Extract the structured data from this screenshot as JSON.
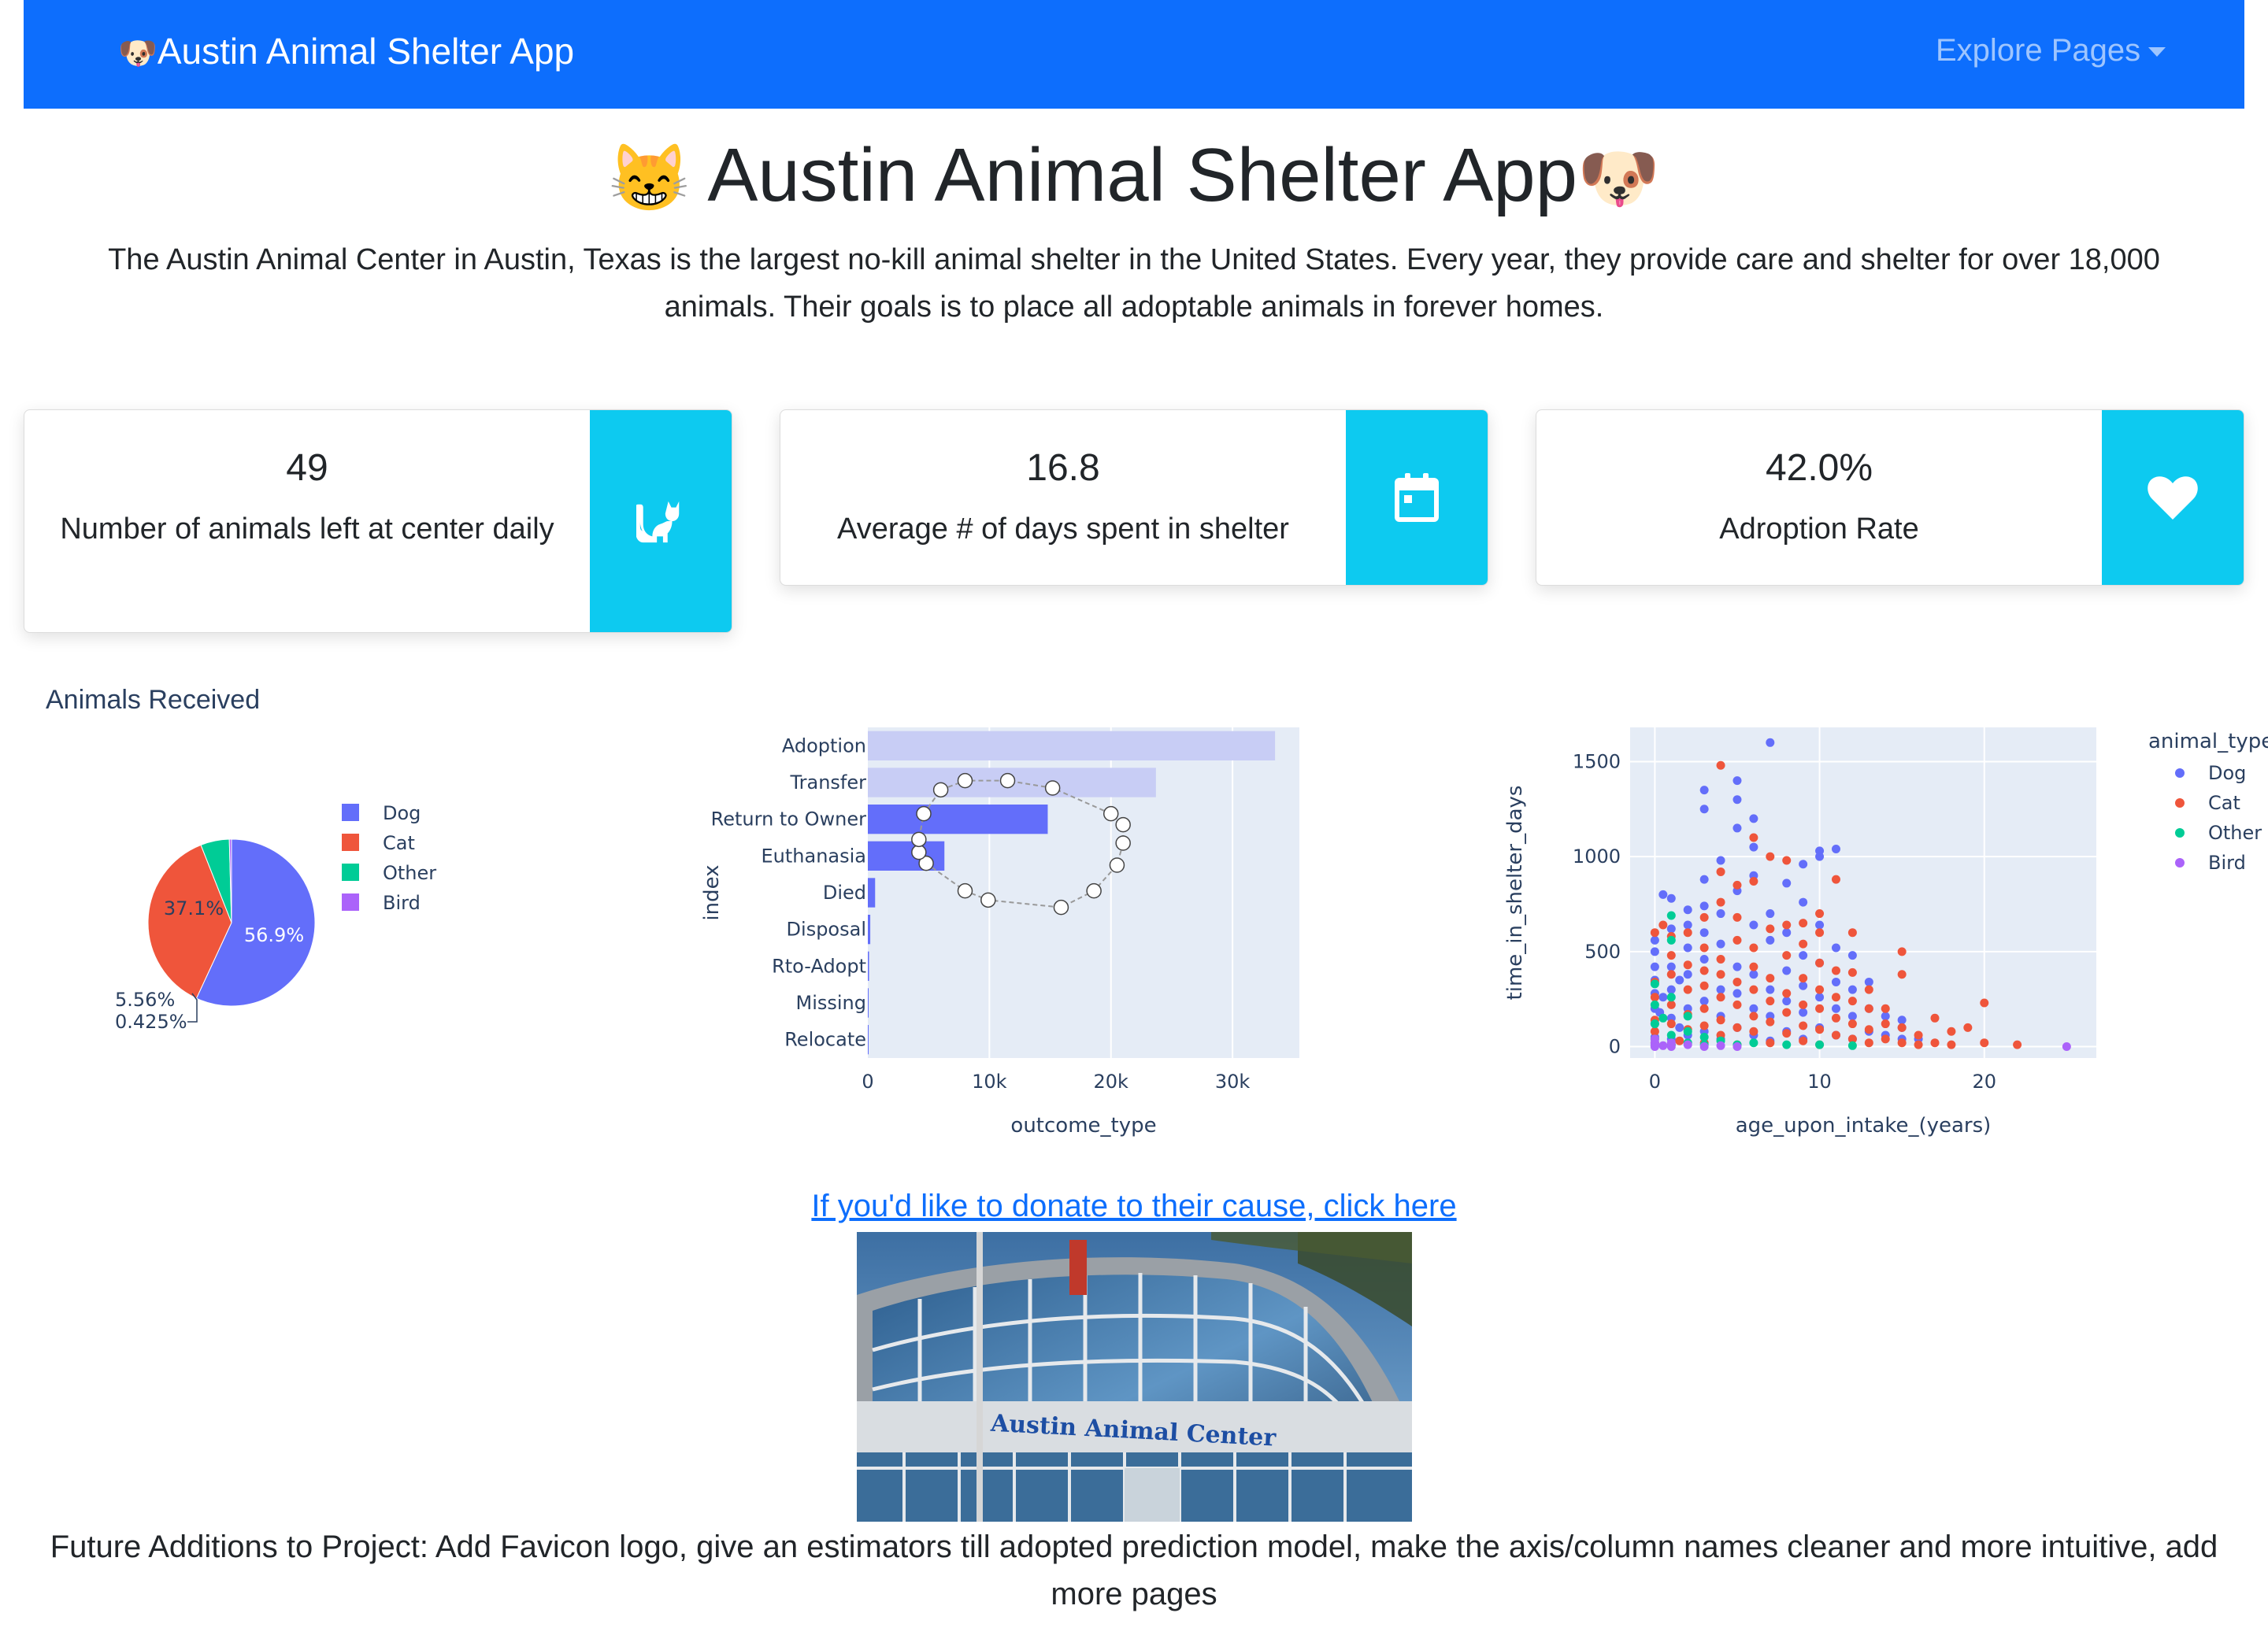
{
  "navbar": {
    "brand": "Austin Animal Shelter App",
    "brand_icon": "dog-face-icon",
    "explore_label": "Explore Pages"
  },
  "header": {
    "title": "Austin Animal Shelter App",
    "title_left_icon": "grinning-cat-icon",
    "title_right_icon": "dog-face-icon",
    "intro": "The Austin Animal Center in Austin, Texas is the largest no-kill animal shelter in the United States. Every year, they provide care and shelter for over 18,000 animals. Their goals is to place all adoptable animals in forever homes."
  },
  "stats": [
    {
      "value": "49",
      "label": "Number of animals left at center daily",
      "icon": "cat-icon"
    },
    {
      "value": "16.8",
      "label": "Average # of days spent in shelter",
      "icon": "calendar-icon"
    },
    {
      "value": "42.0%",
      "label": "Adroption Rate",
      "icon": "heart-icon"
    }
  ],
  "colors": {
    "navbar": "#0d6efd",
    "card_icon_bg": "#0dcaf0",
    "dog": "#636efa",
    "cat": "#EF553B",
    "other": "#00cc96",
    "bird": "#ab63fa",
    "plot_bg": "#e5ecf6",
    "text_dark": "#2a3f5f"
  },
  "chart_data": [
    {
      "type": "pie",
      "title": "Animals Received",
      "labels": [
        "Dog",
        "Cat",
        "Other",
        "Bird"
      ],
      "values": [
        56.9,
        37.1,
        5.56,
        0.425
      ],
      "value_labels": [
        "56.9%",
        "37.1%",
        "5.56%",
        "0.425%"
      ],
      "legend": "right"
    },
    {
      "type": "bar",
      "orientation": "horizontal",
      "categories": [
        "Adoption",
        "Transfer",
        "Return to Owner",
        "Euthanasia",
        "Died",
        "Disposal",
        "Rto-Adopt",
        "Missing",
        "Relocate"
      ],
      "values": [
        33500,
        23700,
        14800,
        6300,
        600,
        200,
        100,
        50,
        20
      ],
      "xlabel": "outcome_type",
      "ylabel": "index",
      "xlim": [
        0,
        35500
      ],
      "xticks": [
        "0",
        "10k",
        "20k",
        "30k"
      ],
      "grid": true,
      "selection_lasso_points": [
        [
          6000,
          1.2
        ],
        [
          8000,
          0.95
        ],
        [
          11500,
          0.95
        ],
        [
          15200,
          1.15
        ],
        [
          20000,
          1.85
        ],
        [
          21000,
          2.15
        ],
        [
          21000,
          2.65
        ],
        [
          20500,
          3.25
        ],
        [
          18600,
          3.95
        ],
        [
          15900,
          4.4
        ],
        [
          9900,
          4.2
        ],
        [
          8000,
          3.95
        ],
        [
          4800,
          3.2
        ],
        [
          4200,
          2.9
        ],
        [
          4200,
          2.55
        ],
        [
          4600,
          1.85
        ]
      ]
    },
    {
      "type": "scatter",
      "xlabel": "age_upon_intake_(years)",
      "ylabel": "time_in_shelter_days",
      "xlim": [
        -1.5,
        26.8
      ],
      "ylim": [
        -60,
        1680
      ],
      "xticks": [
        0,
        10,
        20
      ],
      "yticks": [
        0,
        500,
        1000,
        1500
      ],
      "legend_title": "animal_type",
      "legend": "right",
      "series": [
        {
          "name": "Dog",
          "points": [
            [
              0,
              50
            ],
            [
              0,
              120
            ],
            [
              0,
              200
            ],
            [
              0,
              280
            ],
            [
              0,
              350
            ],
            [
              0,
              420
            ],
            [
              0,
              500
            ],
            [
              0,
              560
            ],
            [
              0.3,
              180
            ],
            [
              0.5,
              260
            ],
            [
              0.5,
              800
            ],
            [
              1,
              40
            ],
            [
              1,
              150
            ],
            [
              1,
              300
            ],
            [
              1,
              420
            ],
            [
              1,
              620
            ],
            [
              1,
              780
            ],
            [
              1.5,
              100
            ],
            [
              1.5,
              350
            ],
            [
              2,
              60
            ],
            [
              2,
              200
            ],
            [
              2,
              380
            ],
            [
              2,
              520
            ],
            [
              2,
              640
            ],
            [
              2,
              720
            ],
            [
              3,
              80
            ],
            [
              3,
              240
            ],
            [
              3,
              460
            ],
            [
              3,
              600
            ],
            [
              3,
              740
            ],
            [
              3,
              880
            ],
            [
              3,
              1250
            ],
            [
              3,
              1350
            ],
            [
              4,
              40
            ],
            [
              4,
              160
            ],
            [
              4,
              300
            ],
            [
              4,
              540
            ],
            [
              4,
              700
            ],
            [
              4,
              980
            ],
            [
              5,
              100
            ],
            [
              5,
              280
            ],
            [
              5,
              420
            ],
            [
              5,
              820
            ],
            [
              5,
              1150
            ],
            [
              5,
              1300
            ],
            [
              5,
              1400
            ],
            [
              6,
              60
            ],
            [
              6,
              200
            ],
            [
              6,
              380
            ],
            [
              6,
              640
            ],
            [
              6,
              900
            ],
            [
              6,
              1050
            ],
            [
              6,
              1200
            ],
            [
              7,
              30
            ],
            [
              7,
              160
            ],
            [
              7,
              300
            ],
            [
              7,
              560
            ],
            [
              7,
              700
            ],
            [
              7,
              1600
            ],
            [
              8,
              80
            ],
            [
              8,
              240
            ],
            [
              8,
              400
            ],
            [
              8,
              600
            ],
            [
              8,
              860
            ],
            [
              9,
              40
            ],
            [
              9,
              180
            ],
            [
              9,
              320
            ],
            [
              9,
              480
            ],
            [
              9,
              760
            ],
            [
              9,
              960
            ],
            [
              10,
              100
            ],
            [
              10,
              260
            ],
            [
              10,
              440
            ],
            [
              10,
              640
            ],
            [
              10,
              1000
            ],
            [
              10,
              1030
            ],
            [
              11,
              60
            ],
            [
              11,
              200
            ],
            [
              11,
              340
            ],
            [
              11,
              520
            ],
            [
              11,
              1040
            ],
            [
              12,
              40
            ],
            [
              12,
              160
            ],
            [
              12,
              300
            ],
            [
              12,
              480
            ],
            [
              13,
              80
            ],
            [
              13,
              200
            ],
            [
              13,
              340
            ],
            [
              14,
              60
            ],
            [
              14,
              160
            ],
            [
              15,
              40
            ],
            [
              15,
              140
            ],
            [
              15,
              100
            ],
            [
              16,
              40
            ]
          ]
        },
        {
          "name": "Cat",
          "points": [
            [
              0,
              20
            ],
            [
              0,
              80
            ],
            [
              0,
              140
            ],
            [
              0,
              260
            ],
            [
              0,
              340
            ],
            [
              0,
              600
            ],
            [
              0.5,
              640
            ],
            [
              1,
              10
            ],
            [
              1,
              120
            ],
            [
              1,
              220
            ],
            [
              1,
              380
            ],
            [
              1,
              480
            ],
            [
              1,
              580
            ],
            [
              1.5,
              30
            ],
            [
              2,
              90
            ],
            [
              2,
              170
            ],
            [
              2,
              300
            ],
            [
              2,
              430
            ],
            [
              2,
              600
            ],
            [
              3,
              20
            ],
            [
              3,
              110
            ],
            [
              3,
              200
            ],
            [
              3,
              320
            ],
            [
              3,
              400
            ],
            [
              3,
              520
            ],
            [
              3,
              680
            ],
            [
              4,
              1480
            ],
            [
              4,
              60
            ],
            [
              4,
              140
            ],
            [
              4,
              260
            ],
            [
              4,
              380
            ],
            [
              4,
              460
            ],
            [
              4,
              760
            ],
            [
              4,
              920
            ],
            [
              5,
              10
            ],
            [
              5,
              100
            ],
            [
              5,
              220
            ],
            [
              5,
              340
            ],
            [
              5,
              560
            ],
            [
              5,
              680
            ],
            [
              5,
              850
            ],
            [
              6,
              80
            ],
            [
              6,
              160
            ],
            [
              6,
              300
            ],
            [
              6,
              420
            ],
            [
              6,
              520
            ],
            [
              6,
              870
            ],
            [
              6,
              1100
            ],
            [
              7,
              20
            ],
            [
              7,
              130
            ],
            [
              7,
              240
            ],
            [
              7,
              360
            ],
            [
              7,
              620
            ],
            [
              7,
              1000
            ],
            [
              8,
              70
            ],
            [
              8,
              180
            ],
            [
              8,
              280
            ],
            [
              8,
              480
            ],
            [
              8,
              640
            ],
            [
              8,
              980
            ],
            [
              9,
              30
            ],
            [
              9,
              110
            ],
            [
              9,
              220
            ],
            [
              9,
              360
            ],
            [
              9,
              540
            ],
            [
              9,
              650
            ],
            [
              10,
              10
            ],
            [
              10,
              90
            ],
            [
              10,
              200
            ],
            [
              10,
              300
            ],
            [
              10,
              440
            ],
            [
              10,
              600
            ],
            [
              10,
              700
            ],
            [
              11,
              60
            ],
            [
              11,
              150
            ],
            [
              11,
              260
            ],
            [
              11,
              400
            ],
            [
              11,
              880
            ],
            [
              12,
              40
            ],
            [
              12,
              120
            ],
            [
              12,
              240
            ],
            [
              12,
              390
            ],
            [
              12,
              600
            ],
            [
              13,
              20
            ],
            [
              13,
              90
            ],
            [
              13,
              200
            ],
            [
              13,
              300
            ],
            [
              14,
              40
            ],
            [
              14,
              120
            ],
            [
              14,
              200
            ],
            [
              15,
              20
            ],
            [
              15,
              100
            ],
            [
              15,
              500
            ],
            [
              15,
              380
            ],
            [
              16,
              10
            ],
            [
              16,
              60
            ],
            [
              17,
              20
            ],
            [
              17,
              150
            ],
            [
              18,
              10
            ],
            [
              18,
              80
            ],
            [
              19,
              100
            ],
            [
              20,
              20
            ],
            [
              20,
              230
            ],
            [
              22,
              10
            ]
          ]
        },
        {
          "name": "Other",
          "points": [
            [
              0,
              5
            ],
            [
              0,
              40
            ],
            [
              0,
              120
            ],
            [
              0,
              220
            ],
            [
              0,
              330
            ],
            [
              0.5,
              150
            ],
            [
              1,
              10
            ],
            [
              1,
              60
            ],
            [
              1,
              260
            ],
            [
              1,
              560
            ],
            [
              1,
              690
            ],
            [
              2,
              20
            ],
            [
              2,
              80
            ],
            [
              2,
              160
            ],
            [
              3,
              10
            ],
            [
              3,
              50
            ],
            [
              4,
              30
            ],
            [
              5,
              10
            ],
            [
              6,
              20
            ],
            [
              8,
              10
            ],
            [
              10,
              10
            ],
            [
              12,
              5
            ]
          ]
        },
        {
          "name": "Bird",
          "points": [
            [
              0,
              0
            ],
            [
              0,
              10
            ],
            [
              0,
              20
            ],
            [
              0,
              40
            ],
            [
              0.5,
              5
            ],
            [
              1,
              0
            ],
            [
              1,
              20
            ],
            [
              2,
              10
            ],
            [
              3,
              0
            ],
            [
              4,
              5
            ],
            [
              5,
              0
            ],
            [
              25,
              0
            ]
          ]
        }
      ]
    }
  ],
  "donate": {
    "text": "If you'd like to donate to their cause, click here"
  },
  "photo": {
    "sign_text": "Austin Animal Center"
  },
  "future": {
    "text": "Future Additions to Project: Add Favicon logo, give an estimators till adopted prediction model, make the axis/column names cleaner and more intuitive, add more pages"
  }
}
